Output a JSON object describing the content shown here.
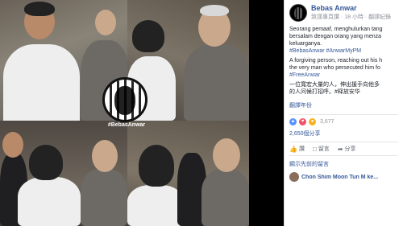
{
  "page": {
    "name": "Bebas Anwar",
    "meta": "致謹專頁讚 · 18 小時 · 翻譯紀錄"
  },
  "post": {
    "malay_line1": "Seorang pemaaf, menghulurkan tang",
    "malay_line2": "bersalam dengan orang yang menza",
    "malay_line3": "keluarganya.",
    "malay_tags": "#BebasAnwar #AnwarMyPM",
    "english_line1": "A forgiving person, reaching out his h",
    "english_line2": "the very man who persecuted him fo",
    "english_tag": "#FreeAnwar",
    "chinese_line1": "一位寬宏大量的人，伸出援手向他多",
    "chinese_line2": "的人问候打招呼。#释放安华",
    "see_translation": "翻譯年份"
  },
  "image_caption": "#BebasAnwar",
  "reactions": {
    "count": "3,677",
    "like_icon": "like-icon",
    "love_icon": "love-icon",
    "wow_icon": "wow-icon"
  },
  "shares": "2,650個分享",
  "actions": {
    "like": "讚",
    "comment": "留言",
    "share": "分享"
  },
  "comments": {
    "previous": "顯示先前的留言",
    "first_author": "Chon Shim Moon Tun M ke..."
  }
}
